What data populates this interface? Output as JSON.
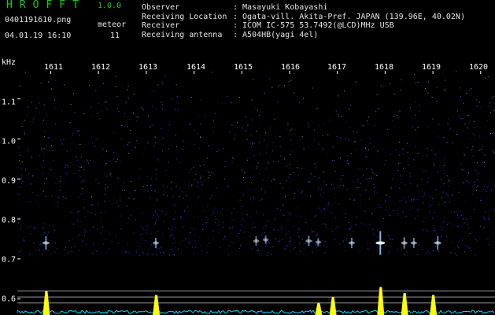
{
  "app": {
    "title": "HROFFT",
    "version": "1.0.0",
    "filename": "0401191610.png",
    "meteor_label": "meteor",
    "meteor_count": "11",
    "datetime": "04.01.19 16:10"
  },
  "meta": [
    {
      "key": "Observer",
      "colon": ":",
      "value": "Masayuki Kobayashi"
    },
    {
      "key": "Receiving Location",
      "colon": ":",
      "value": "Ogata-vill. Akita-Pref. JAPAN (139.96E, 40.02N)"
    },
    {
      "key": "Receiver",
      "colon": ":",
      "value": "ICOM IC-575 53.7492(@LCD)MHz USB"
    },
    {
      "key": "Receiving antenna",
      "colon": ":",
      "value": "A504HB(yagi 4el)"
    }
  ],
  "colors": {
    "title_green": "#19c81e",
    "text": "#e6e6e6",
    "noise": "#3a3aff",
    "echo": "#7ab8ff",
    "level": "#ffff00",
    "baseline": "#00d8ff",
    "grid": "#9a9a9a"
  },
  "chart_data": {
    "type": "heatmap",
    "y_unit": "kHz",
    "x_ticks": [
      "1611",
      "1612",
      "1613",
      "1614",
      "1615",
      "1616",
      "1617",
      "1618",
      "1619",
      "1620"
    ],
    "y_ticks": [
      "1.1",
      "1.0",
      "0.9",
      "0.8",
      "0.7",
      "0.6"
    ],
    "y_tick_values": [
      1.1,
      1.0,
      0.9,
      0.8,
      0.7,
      0.6
    ],
    "y_range": [
      0.56,
      1.17
    ],
    "x_range": [
      1610.3,
      1620.3
    ],
    "echoes": [
      {
        "x": 1610.9,
        "y": 0.74,
        "strength": 0.5
      },
      {
        "x": 1613.2,
        "y": 0.74,
        "strength": 0.35
      },
      {
        "x": 1615.3,
        "y": 0.745,
        "strength": 0.3
      },
      {
        "x": 1616.4,
        "y": 0.745,
        "strength": 0.35
      },
      {
        "x": 1617.3,
        "y": 0.74,
        "strength": 0.35
      },
      {
        "x": 1617.9,
        "y": 0.74,
        "strength": 1.0
      },
      {
        "x": 1618.4,
        "y": 0.74,
        "strength": 0.4
      },
      {
        "x": 1618.6,
        "y": 0.74,
        "strength": 0.35
      },
      {
        "x": 1619.1,
        "y": 0.74,
        "strength": 0.5
      },
      {
        "x": 1615.5,
        "y": 0.748,
        "strength": 0.25
      },
      {
        "x": 1616.6,
        "y": 0.742,
        "strength": 0.25
      }
    ],
    "level_peaks": [
      {
        "x": 1610.9,
        "level": 0.62
      },
      {
        "x": 1613.2,
        "level": 0.61
      },
      {
        "x": 1616.6,
        "level": 0.59
      },
      {
        "x": 1616.9,
        "level": 0.605
      },
      {
        "x": 1617.9,
        "level": 0.63
      },
      {
        "x": 1618.4,
        "level": 0.615
      },
      {
        "x": 1619.0,
        "level": 0.61
      }
    ],
    "level_ref_lines": [
      0.62,
      0.605,
      0.59
    ]
  }
}
